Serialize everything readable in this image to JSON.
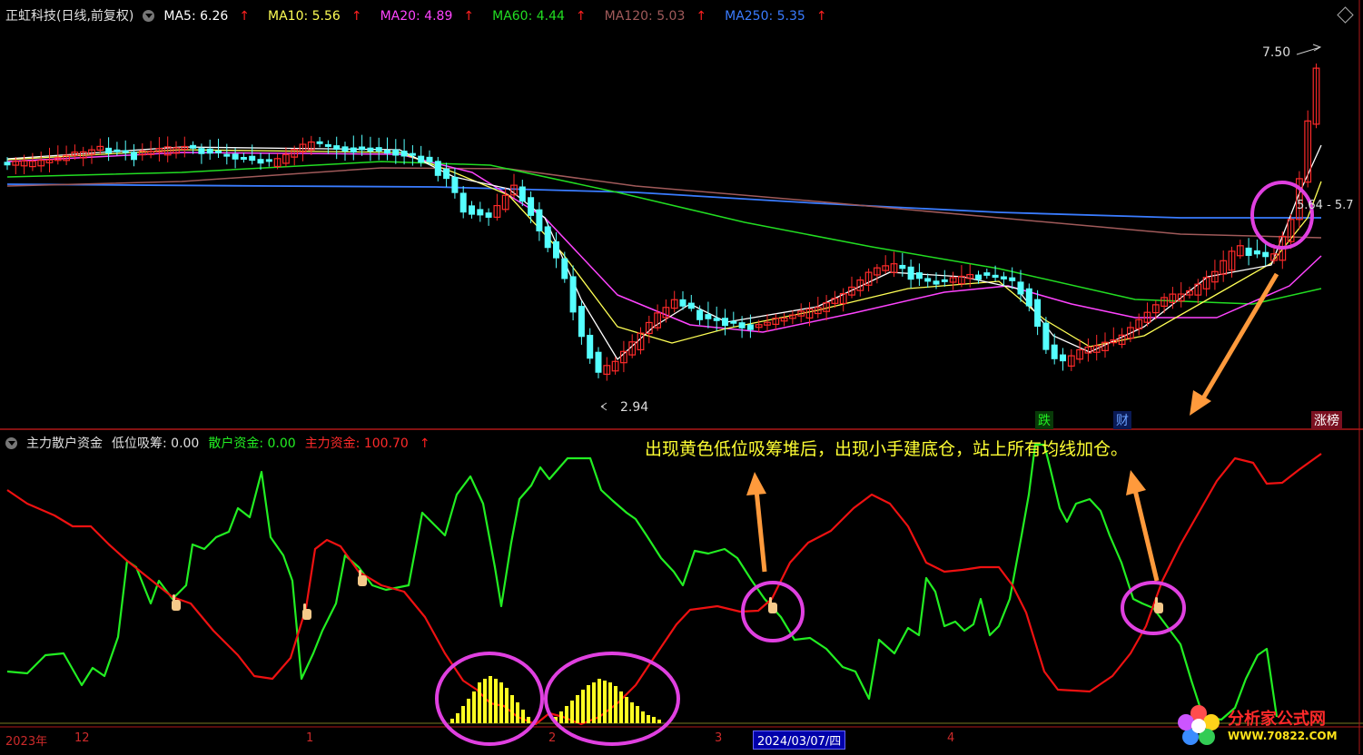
{
  "header": {
    "stock": "正虹科技(日线,前复权)",
    "ma5": "MA5: 6.26",
    "ma10": "MA10: 5.56",
    "ma20": "MA20: 4.89",
    "ma60": "MA60: 4.44",
    "ma120": "MA120: 5.03",
    "ma250": "MA250: 5.35",
    "up_arrow": "↑"
  },
  "price_labels": {
    "high": "7.50",
    "low": "2.94",
    "right": "5.64 - 5.7"
  },
  "tags": {
    "die": "跌",
    "cai": "财",
    "zhangbang": "涨榜"
  },
  "indicator": {
    "name": "主力散户资金",
    "lowpos": "低位吸筹: 0.00",
    "retail": "散户资金: 0.00",
    "main": "主力资金: 100.70"
  },
  "annotation": "出现黄色低位吸筹堆后，出现小手建底仓，站上所有均线加仓。",
  "axis": {
    "year": "2023年",
    "m12": "12",
    "m1": "1",
    "m2": "2",
    "m3": "3",
    "date": "2024/03/07/四",
    "m4": "4"
  },
  "watermark": {
    "name": "分析家公式网",
    "url": "WWW.70822.COM"
  },
  "colors": {
    "ma5": "#ffffff",
    "ma10": "#ffff55",
    "ma20": "#ff44ff",
    "ma60": "#22dd22",
    "ma120": "#a05a5a",
    "ma250": "#3a7cff",
    "up": "#ff2a2a",
    "down": "#55ffff",
    "retail": "#22ee22",
    "main": "#ee1111",
    "lowpos": "#ffff22",
    "marker": "#e040e0",
    "arrow": "#ff9a3c"
  }
}
